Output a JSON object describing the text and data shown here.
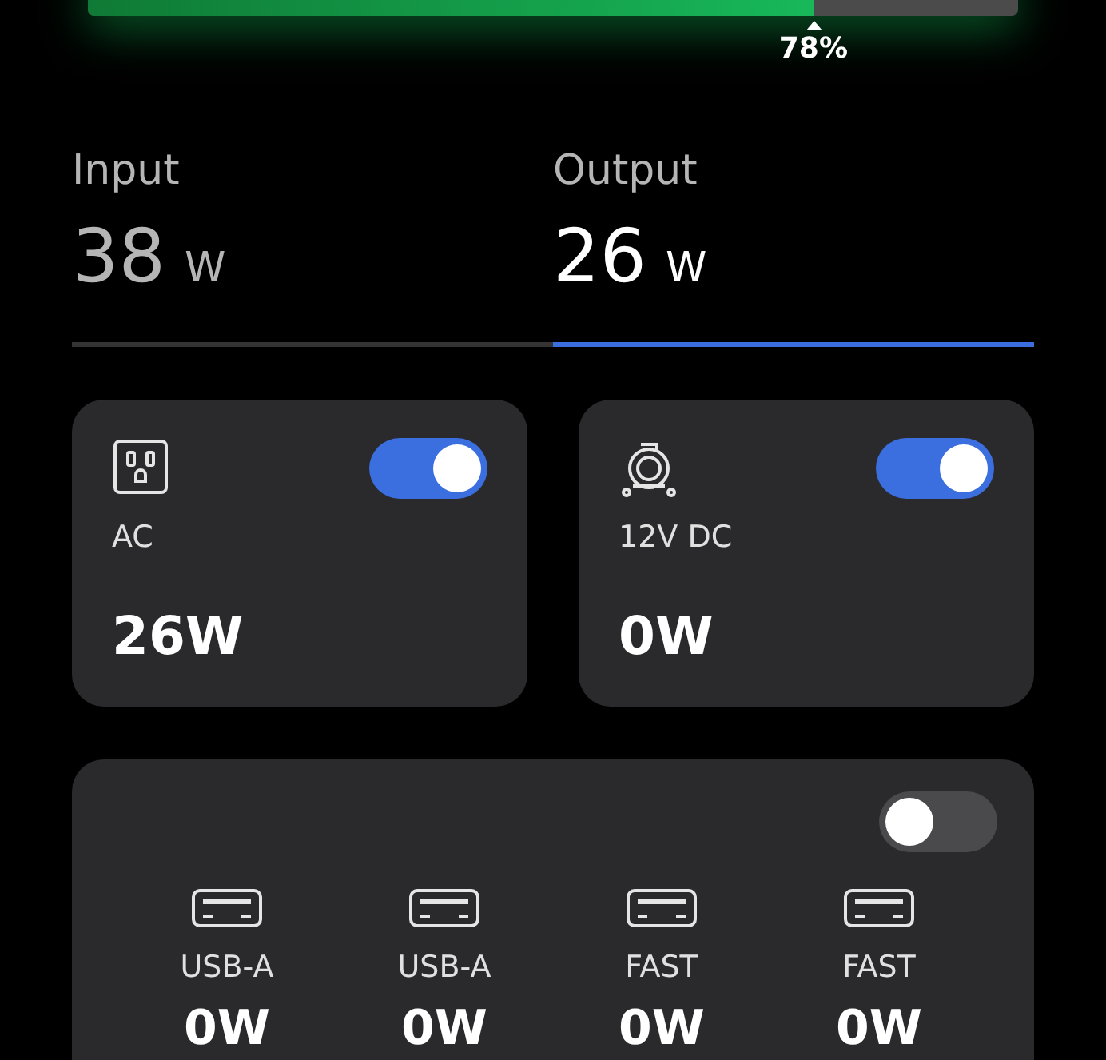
{
  "battery": {
    "level": 0.78,
    "reading": "78%"
  },
  "tabs": [
    {
      "label": "Input",
      "value": "38",
      "unit": "W",
      "selected": false
    },
    {
      "label": "Output",
      "value": "26",
      "unit": "W",
      "selected": true
    }
  ],
  "outputs": [
    {
      "kind": "ac",
      "label": "AC",
      "reading": "26W",
      "on": true
    },
    {
      "kind": "dc",
      "label": "12V DC",
      "reading": "0W",
      "on": true
    }
  ],
  "usb": {
    "on": false,
    "ports": [
      {
        "label": "USB-A",
        "reading": "0W"
      },
      {
        "label": "USB-A",
        "reading": "0W"
      },
      {
        "label": "FAST",
        "reading": "0W"
      },
      {
        "label": "FAST",
        "reading": "0W"
      }
    ]
  }
}
